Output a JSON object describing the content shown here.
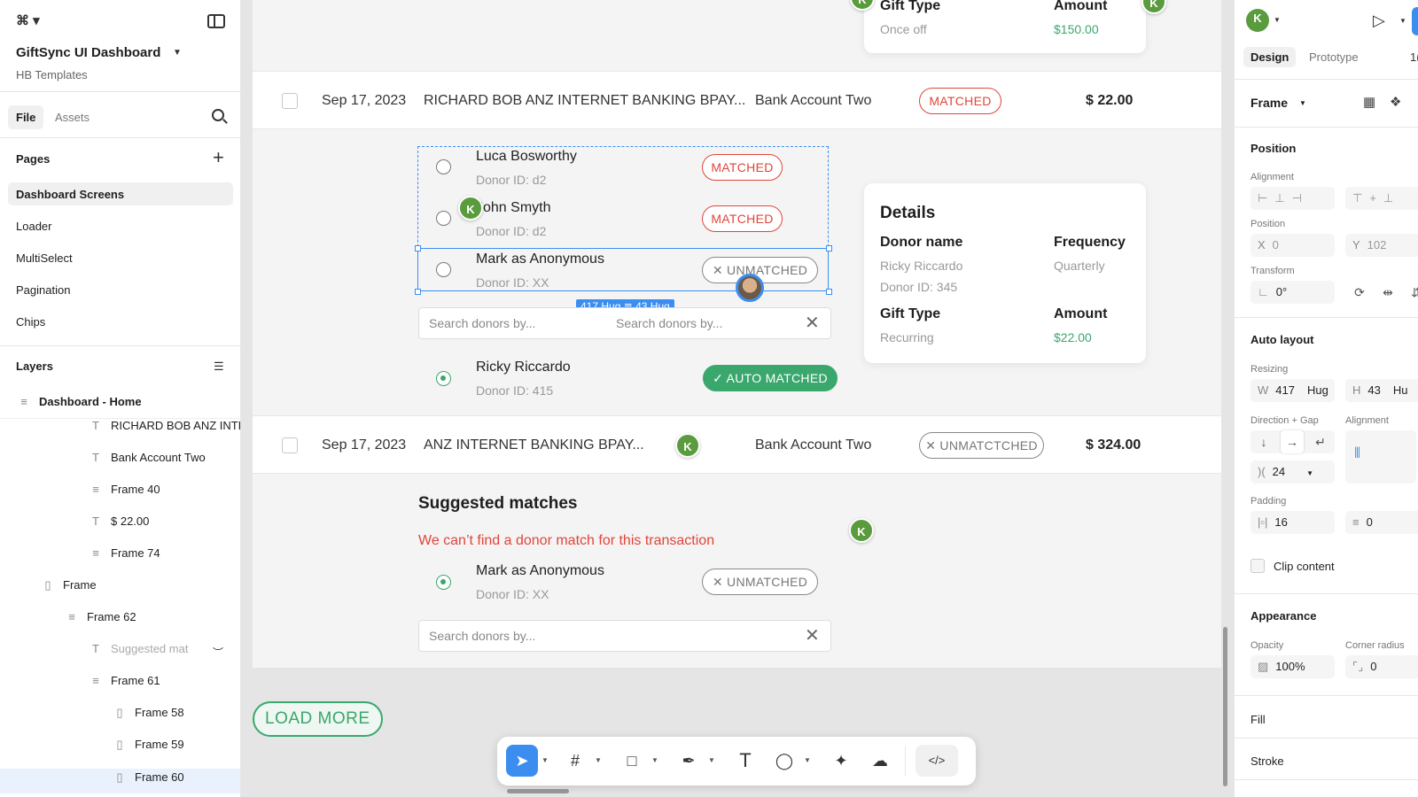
{
  "sidebar": {
    "logo": "⌘ ▾",
    "project_title": "GiftSync UI Dashboard",
    "project_subtitle": "HB Templates",
    "tabs": {
      "file": "File",
      "assets": "Assets"
    },
    "pages_title": "Pages",
    "pages": [
      "Dashboard Screens",
      "Loader",
      "MultiSelect",
      "Pagination",
      "Chips"
    ],
    "layers_title": "Layers",
    "root_layer": "Dashboard - Home",
    "layers": [
      {
        "label": "RICHARD BOB ANZ INTERNET",
        "icon": "T"
      },
      {
        "label": "Bank Account Two",
        "icon": "T"
      },
      {
        "label": "Frame 40",
        "icon": "≡"
      },
      {
        "label": "$ 22.00",
        "icon": "T"
      },
      {
        "label": "Frame 74",
        "icon": "≡"
      },
      {
        "label": "Frame",
        "icon": "▯"
      },
      {
        "label": "Frame 62",
        "icon": "≡"
      },
      {
        "label": "Suggested mat",
        "icon": "T"
      },
      {
        "label": "Frame 61",
        "icon": "≡"
      },
      {
        "label": "Frame 58",
        "icon": "▯"
      },
      {
        "label": "Frame 59",
        "icon": "▯"
      },
      {
        "label": "Frame 60",
        "icon": "▯"
      }
    ]
  },
  "canvas": {
    "top_card": {
      "gift_type_label": "Gift Type",
      "gift_type_value": "Once off",
      "amount_label": "Amount",
      "amount_value": "$150.00"
    },
    "row1": {
      "date": "Sep 17, 2023",
      "description": "RICHARD BOB ANZ INTERNET BANKING BPAY...",
      "account": "Bank Account Two",
      "status": "MATCHED",
      "amount": "$ 22.00"
    },
    "donors": [
      {
        "name": "Luca Bosworthy",
        "id": "Donor ID: d2",
        "status": "MATCHED"
      },
      {
        "name": "John Smyth",
        "id": "Donor ID: d2",
        "status": "MATCHED"
      },
      {
        "name": "Mark as Anonymous",
        "id": "Donor ID: XX",
        "status": "✕ UNMATCHED"
      }
    ],
    "dimension_badge": "417 Hug ≣ 43 Hug",
    "search1": {
      "placeholder": "Search donors by...",
      "placeholder2": "Search donors by..."
    },
    "auto_donor": {
      "name": "Ricky Riccardo",
      "id": "Donor ID: 415",
      "status": "✓ AUTO MATCHED"
    },
    "details": {
      "title": "Details",
      "donor_name_label": "Donor name",
      "donor_name_value": "Ricky Riccardo",
      "donor_id": "Donor ID: 345",
      "frequency_label": "Frequency",
      "frequency_value": "Quarterly",
      "gift_type_label": "Gift Type",
      "gift_type_value": "Recurring",
      "amount_label": "Amount",
      "amount_value": "$22.00"
    },
    "row2": {
      "date": "Sep 17, 2023",
      "description": "ANZ INTERNET BANKING BPAY...",
      "account": "Bank Account Two",
      "status": "✕ UNMATCTCHED",
      "amount": "$ 324.00"
    },
    "suggested": {
      "title": "Suggested matches",
      "error_text": "We can’t find a donor match for this transaction",
      "donor_name": "Mark as Anonymous",
      "donor_id": "Donor ID: XX",
      "donor_status": "✕ UNMATCHED",
      "search_placeholder": "Search donors by..."
    },
    "load_more": "LOAD MORE",
    "avatar_initial": "K"
  },
  "toolbar": {
    "tools": [
      "move-tool",
      "frame-tool",
      "shape-tool",
      "pen-tool",
      "text-tool",
      "comment-tool",
      "actions-tool",
      "hand-tool",
      "dev-mode-toggle"
    ],
    "dev_mode": "</>"
  },
  "right_panel": {
    "avatar_initial": "K",
    "tabs": {
      "design": "Design",
      "prototype": "Prototype",
      "extra": "1("
    },
    "frame_label": "Frame",
    "position_title": "Position",
    "alignment_label": "Alignment",
    "position_label": "Position",
    "x_label": "X",
    "x_value": "0",
    "y_label": "Y",
    "y_value": "102",
    "transform_label": "Transform",
    "rotation": "0°",
    "auto_layout_title": "Auto layout",
    "resizing_label": "Resizing",
    "w_label": "W",
    "w_value": "417",
    "w_mode": "Hug",
    "h_label": "H",
    "h_value": "43",
    "h_mode": "Hu",
    "direction_label": "Direction + Gap",
    "alignment2_label": "Alignment",
    "gap_value": "24",
    "padding_label": "Padding",
    "padding_h": "16",
    "padding_v": "0",
    "clip_content": "Clip content",
    "appearance_title": "Appearance",
    "opacity_label": "Opacity",
    "opacity_value": "100%",
    "corner_label": "Corner radius",
    "corner_value": "0",
    "fill_title": "Fill",
    "stroke_title": "Stroke"
  },
  "colors": {
    "accent": "#3b8ef0",
    "green": "#3aa76d",
    "red": "#e0453a"
  }
}
